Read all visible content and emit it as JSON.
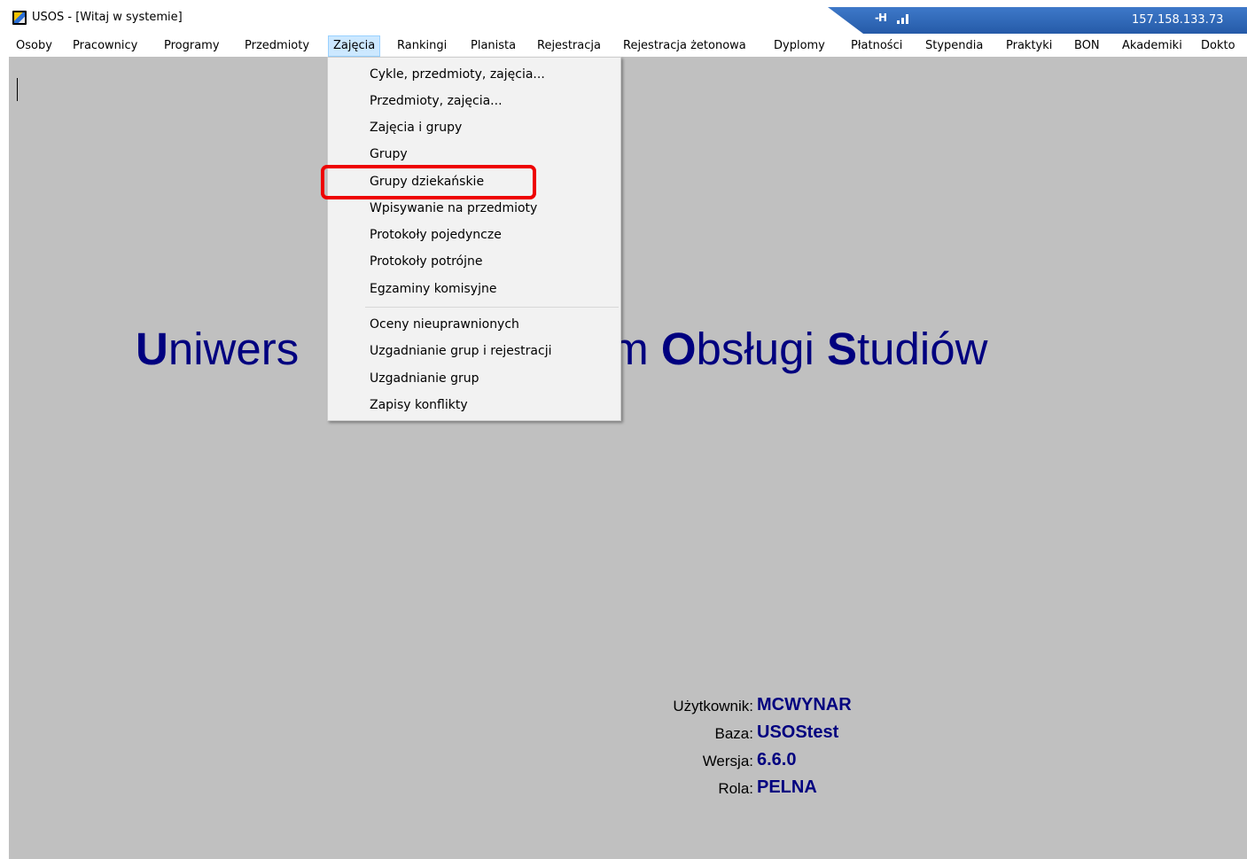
{
  "window": {
    "title": "USOS - [Witaj w systemie]",
    "connection_ip": "157.158.133.73"
  },
  "menubar": {
    "items": [
      {
        "label": "Osoby"
      },
      {
        "label": "Pracownicy"
      },
      {
        "label": "Programy"
      },
      {
        "label": "Przedmioty"
      },
      {
        "label": "Zajęcia",
        "active": true
      },
      {
        "label": "Rankingi"
      },
      {
        "label": "Planista"
      },
      {
        "label": "Rejestracja"
      },
      {
        "label": "Rejestracja żetonowa"
      },
      {
        "label": "Dyplomy"
      },
      {
        "label": "Płatności"
      },
      {
        "label": "Stypendia"
      },
      {
        "label": "Praktyki"
      },
      {
        "label": "BON"
      },
      {
        "label": "Akademiki"
      },
      {
        "label": "Dokto"
      }
    ]
  },
  "dropdown": {
    "items": [
      {
        "label": "Cykle, przedmioty, zajęcia..."
      },
      {
        "label": "Przedmioty, zajęcia..."
      },
      {
        "label": "Zajęcia i grupy"
      },
      {
        "label": "Grupy"
      },
      {
        "label": "Grupy dziekańskie",
        "highlighted": true
      },
      {
        "label": "Wpisywanie na przedmioty"
      },
      {
        "label": "Protokoły pojedyncze"
      },
      {
        "label": "Protokoły potrójne"
      },
      {
        "label": "Egzaminy komisyjne"
      },
      {
        "label": "Oceny nieuprawnionych"
      },
      {
        "label": "Uzgadnianie grup i rejestracji"
      },
      {
        "label": "Uzgadnianie grup"
      },
      {
        "label": "Zapisy konflikty"
      }
    ]
  },
  "banner": {
    "u": "U",
    "part1": "niwers",
    "part2": "m ",
    "o": "O",
    "part3": "bsługi ",
    "s": "S",
    "part4": "tudiów"
  },
  "info": {
    "user_label": "Użytkownik:",
    "user_value": "MCWYNAR",
    "db_label": "Baza:",
    "db_value": "USOStest",
    "version_label": "Wersja:",
    "version_value": "6.6.0",
    "role_label": "Rola:",
    "role_value": "PELNA"
  },
  "colors": {
    "banner_text": "#00007f",
    "highlight": "#ee0000",
    "workspace": "#c0c0c0"
  }
}
